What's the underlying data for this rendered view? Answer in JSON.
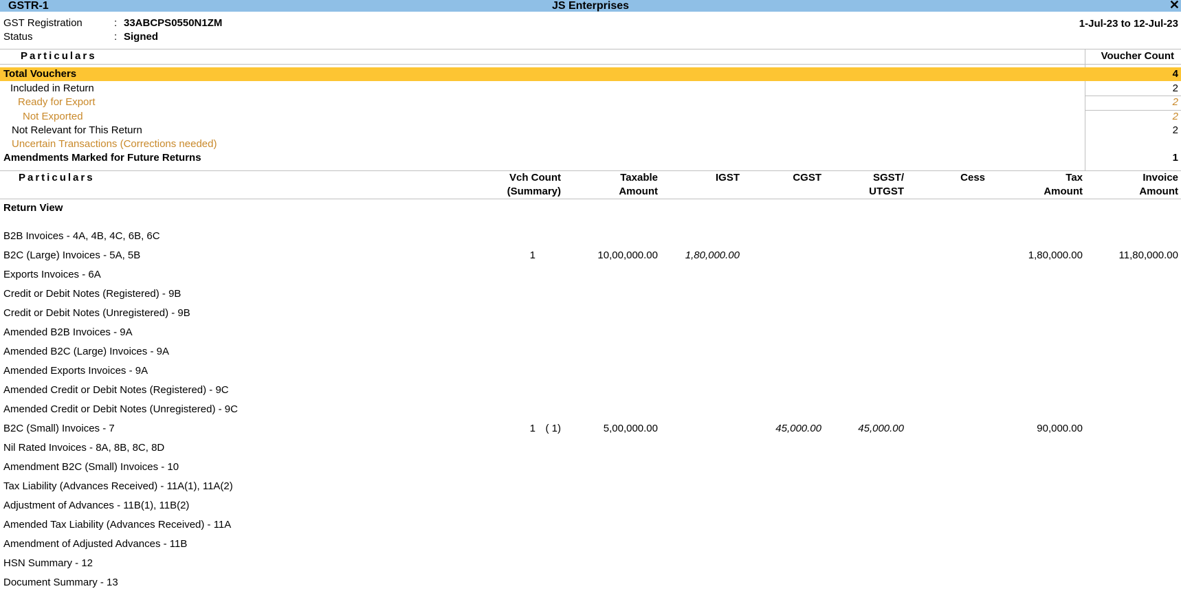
{
  "window": {
    "report_name": "GSTR-1",
    "company": "JS Enterprises",
    "close_icon": "close-icon",
    "close_glyph": "✕"
  },
  "header": {
    "gst_label": "GST Registration",
    "gst_value": "33ABCPS0550N1ZM",
    "status_label": "Status",
    "status_value": "Signed",
    "colon": ":",
    "period": "1-Jul-23 to 12-Jul-23"
  },
  "summary": {
    "particulars_header": "Particulars",
    "count_header": "Voucher Count",
    "rows": [
      {
        "label": "Total Vouchers",
        "count": "4"
      },
      {
        "label": "Included in Return",
        "count": "2"
      },
      {
        "label": "Ready for Export",
        "count": "2"
      },
      {
        "label": "Not Exported",
        "count": "2"
      },
      {
        "label": "Not Relevant for This Return",
        "count": "2"
      },
      {
        "label": "Uncertain Transactions (Corrections needed)",
        "count": ""
      },
      {
        "label": "Amendments Marked for Future Returns",
        "count": "1"
      }
    ]
  },
  "return_table": {
    "headers": {
      "particulars": "Particulars",
      "vch_count_1": "Vch Count",
      "vch_count_2": "(Summary)",
      "taxable_1": "Taxable",
      "taxable_2": "Amount",
      "igst": "IGST",
      "cgst": "CGST",
      "sgst_1": "SGST/",
      "sgst_2": "UTGST",
      "cess": "Cess",
      "tax_1": "Tax",
      "tax_2": "Amount",
      "invoice_1": "Invoice",
      "invoice_2": "Amount"
    },
    "section_title": "Return View",
    "rows": [
      {
        "label": "B2B Invoices - 4A, 4B, 4C, 6B, 6C",
        "vch": "",
        "summary": "",
        "taxable": "",
        "igst": "",
        "cgst": "",
        "sgst": "",
        "cess": "",
        "tax": "",
        "invoice": ""
      },
      {
        "label": "B2C (Large) Invoices - 5A, 5B",
        "vch": "1",
        "summary": "",
        "taxable": "10,00,000.00",
        "igst": "1,80,000.00",
        "cgst": "",
        "sgst": "",
        "cess": "",
        "tax": "1,80,000.00",
        "invoice": "11,80,000.00"
      },
      {
        "label": "Exports Invoices - 6A",
        "vch": "",
        "summary": "",
        "taxable": "",
        "igst": "",
        "cgst": "",
        "sgst": "",
        "cess": "",
        "tax": "",
        "invoice": ""
      },
      {
        "label": "Credit or Debit Notes (Registered) - 9B",
        "vch": "",
        "summary": "",
        "taxable": "",
        "igst": "",
        "cgst": "",
        "sgst": "",
        "cess": "",
        "tax": "",
        "invoice": ""
      },
      {
        "label": "Credit or Debit Notes (Unregistered) - 9B",
        "vch": "",
        "summary": "",
        "taxable": "",
        "igst": "",
        "cgst": "",
        "sgst": "",
        "cess": "",
        "tax": "",
        "invoice": ""
      },
      {
        "label": "Amended B2B Invoices - 9A",
        "vch": "",
        "summary": "",
        "taxable": "",
        "igst": "",
        "cgst": "",
        "sgst": "",
        "cess": "",
        "tax": "",
        "invoice": ""
      },
      {
        "label": "Amended B2C (Large) Invoices - 9A",
        "vch": "",
        "summary": "",
        "taxable": "",
        "igst": "",
        "cgst": "",
        "sgst": "",
        "cess": "",
        "tax": "",
        "invoice": ""
      },
      {
        "label": "Amended Exports Invoices - 9A",
        "vch": "",
        "summary": "",
        "taxable": "",
        "igst": "",
        "cgst": "",
        "sgst": "",
        "cess": "",
        "tax": "",
        "invoice": ""
      },
      {
        "label": "Amended Credit or Debit Notes (Registered) - 9C",
        "vch": "",
        "summary": "",
        "taxable": "",
        "igst": "",
        "cgst": "",
        "sgst": "",
        "cess": "",
        "tax": "",
        "invoice": ""
      },
      {
        "label": "Amended Credit or Debit Notes (Unregistered) - 9C",
        "vch": "",
        "summary": "",
        "taxable": "",
        "igst": "",
        "cgst": "",
        "sgst": "",
        "cess": "",
        "tax": "",
        "invoice": ""
      },
      {
        "label": "B2C (Small) Invoices - 7",
        "vch": "1",
        "summary": "( 1)",
        "taxable": "5,00,000.00",
        "igst": "",
        "cgst": "45,000.00",
        "sgst": "45,000.00",
        "cess": "",
        "tax": "90,000.00",
        "invoice": ""
      },
      {
        "label": "Nil Rated Invoices - 8A, 8B, 8C, 8D",
        "vch": "",
        "summary": "",
        "taxable": "",
        "igst": "",
        "cgst": "",
        "sgst": "",
        "cess": "",
        "tax": "",
        "invoice": ""
      },
      {
        "label": "Amendment B2C (Small) Invoices - 10",
        "vch": "",
        "summary": "",
        "taxable": "",
        "igst": "",
        "cgst": "",
        "sgst": "",
        "cess": "",
        "tax": "",
        "invoice": ""
      },
      {
        "label": "Tax Liability (Advances Received) - 11A(1), 11A(2)",
        "vch": "",
        "summary": "",
        "taxable": "",
        "igst": "",
        "cgst": "",
        "sgst": "",
        "cess": "",
        "tax": "",
        "invoice": ""
      },
      {
        "label": "Adjustment of Advances - 11B(1), 11B(2)",
        "vch": "",
        "summary": "",
        "taxable": "",
        "igst": "",
        "cgst": "",
        "sgst": "",
        "cess": "",
        "tax": "",
        "invoice": ""
      },
      {
        "label": "Amended Tax Liability (Advances Received) - 11A",
        "vch": "",
        "summary": "",
        "taxable": "",
        "igst": "",
        "cgst": "",
        "sgst": "",
        "cess": "",
        "tax": "",
        "invoice": ""
      },
      {
        "label": "Amendment of Adjusted Advances - 11B",
        "vch": "",
        "summary": "",
        "taxable": "",
        "igst": "",
        "cgst": "",
        "sgst": "",
        "cess": "",
        "tax": "",
        "invoice": ""
      },
      {
        "label": "HSN Summary - 12",
        "vch": "",
        "summary": "",
        "taxable": "",
        "igst": "",
        "cgst": "",
        "sgst": "",
        "cess": "",
        "tax": "",
        "invoice": ""
      },
      {
        "label": "Document Summary - 13",
        "vch": "",
        "summary": "",
        "taxable": "",
        "igst": "",
        "cgst": "",
        "sgst": "",
        "cess": "",
        "tax": "",
        "invoice": ""
      }
    ]
  },
  "colors": {
    "titlebar": "#8fbfe6",
    "highlight": "#fdc533",
    "orange_text": "#c9892a"
  }
}
